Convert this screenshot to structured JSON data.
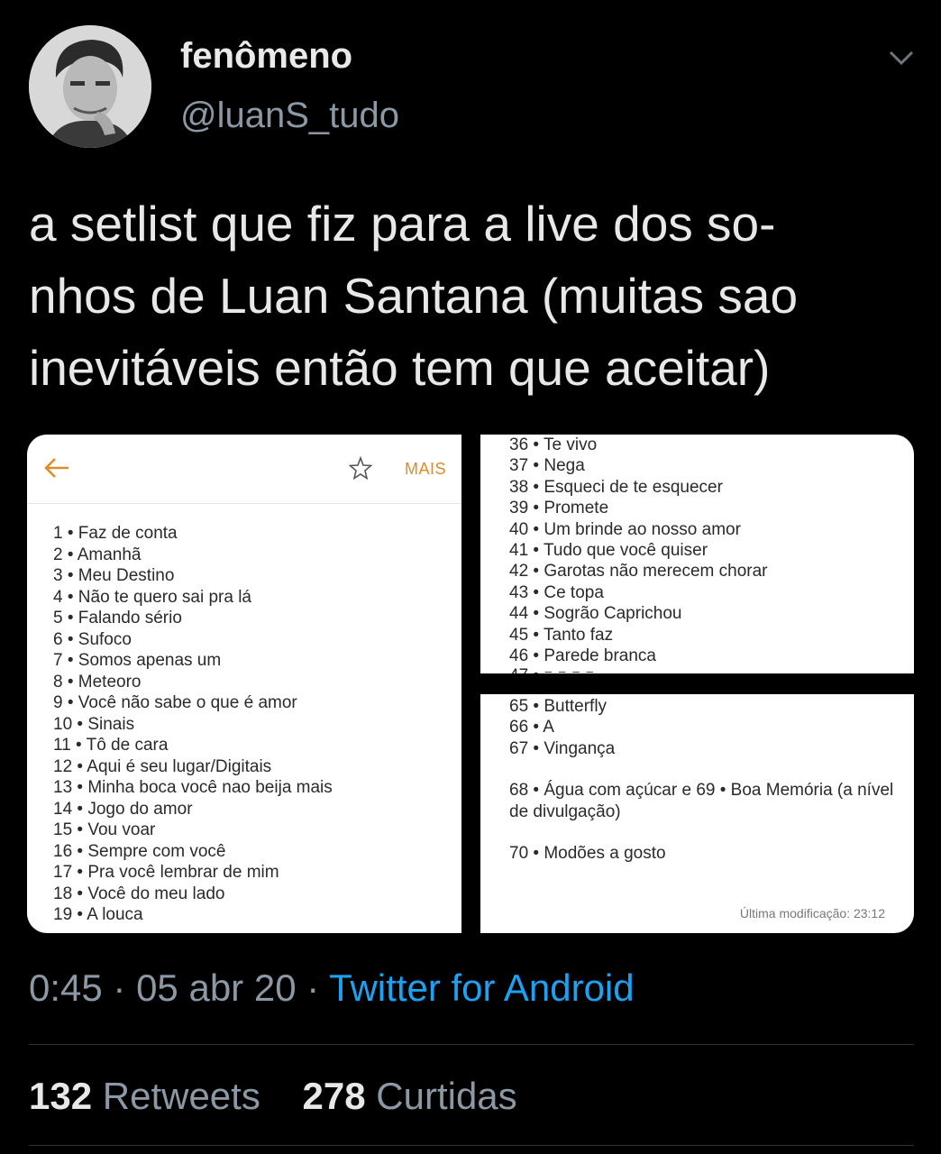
{
  "tweet": {
    "display_name": "fenômeno",
    "handle": "@luanS_tudo",
    "text_lines": [
      "a setlist que fiz para a live dos so-",
      "nhos de Luan Santana (muitas sao",
      "inevitáveis então tem que aceitar)"
    ],
    "time": "0:45",
    "date": "05 abr 20",
    "source": "Twitter for Android",
    "retweets_count": "132",
    "retweets_label": "Retweets",
    "likes_count": "278",
    "likes_label": "Curtidas"
  },
  "screenshot1": {
    "more_label": "MAIS",
    "songs": [
      {
        "n": "1",
        "t": "Faz de conta"
      },
      {
        "n": "2",
        "t": "Amanhã"
      },
      {
        "n": "3",
        "t": "Meu Destino"
      },
      {
        "n": "4",
        "t": "Não te quero sai pra lá"
      },
      {
        "n": "5",
        "t": "Falando sério"
      },
      {
        "n": "6",
        "t": "Sufoco"
      },
      {
        "n": "7",
        "t": "Somos apenas um"
      },
      {
        "n": "8",
        "t": "Meteoro"
      },
      {
        "n": "9",
        "t": "Você não sabe o que é amor"
      },
      {
        "n": "10",
        "t": "Sinais"
      },
      {
        "n": "11",
        "t": "Tô de cara"
      },
      {
        "n": "12",
        "t": "Aqui é seu lugar/Digitais"
      },
      {
        "n": "13",
        "t": "Minha boca você nao beija mais"
      },
      {
        "n": "14",
        "t": "Jogo do amor"
      },
      {
        "n": "15",
        "t": "Vou voar"
      },
      {
        "n": "16",
        "t": "Sempre com você"
      },
      {
        "n": "17",
        "t": "Pra você lembrar de mim"
      },
      {
        "n": "18",
        "t": "Você do meu lado"
      },
      {
        "n": "19",
        "t": "A louca"
      }
    ]
  },
  "screenshot2": {
    "songs": [
      {
        "n": "36",
        "t": "Te vivo"
      },
      {
        "n": "37",
        "t": "Nega"
      },
      {
        "n": "38",
        "t": "Esqueci de te esquecer"
      },
      {
        "n": "39",
        "t": "Promete"
      },
      {
        "n": "40",
        "t": "Um brinde ao nosso amor"
      },
      {
        "n": "41",
        "t": "Tudo que você quiser"
      },
      {
        "n": "42",
        "t": "Garotas não merecem chorar"
      },
      {
        "n": "43",
        "t": "Ce topa"
      },
      {
        "n": "44",
        "t": "Sogrão Caprichou"
      },
      {
        "n": "45",
        "t": "Tanto faz"
      },
      {
        "n": "46",
        "t": "Parede branca"
      }
    ]
  },
  "screenshot3": {
    "songs": [
      {
        "n": "65",
        "t": "Butterfly"
      },
      {
        "n": "66",
        "t": "A"
      },
      {
        "n": "67",
        "t": "Vingança"
      }
    ],
    "line_68": "68 • Água com açúcar e 69 • Boa Memória  (a nível de divulgação)",
    "line_70": "70 • Modões a gosto",
    "modified": "Última modificação: 23:12"
  }
}
